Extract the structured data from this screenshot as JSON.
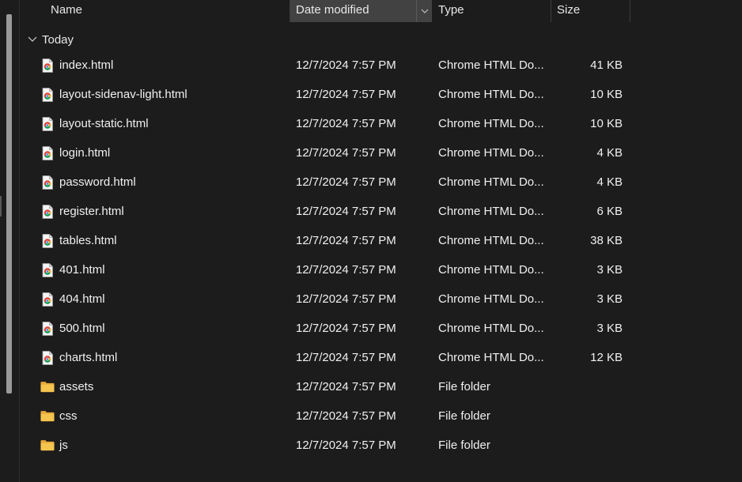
{
  "header": {
    "name_label": "Name",
    "date_label": "Date modified",
    "type_label": "Type",
    "size_label": "Size"
  },
  "group": {
    "label": "Today"
  },
  "files": [
    {
      "name": "index.html",
      "date": "12/7/2024 7:57 PM",
      "type": "Chrome HTML Do...",
      "size": "41 KB",
      "icon": "chrome-html-file-icon"
    },
    {
      "name": "layout-sidenav-light.html",
      "date": "12/7/2024 7:57 PM",
      "type": "Chrome HTML Do...",
      "size": "10 KB",
      "icon": "chrome-html-file-icon"
    },
    {
      "name": "layout-static.html",
      "date": "12/7/2024 7:57 PM",
      "type": "Chrome HTML Do...",
      "size": "10 KB",
      "icon": "chrome-html-file-icon"
    },
    {
      "name": "login.html",
      "date": "12/7/2024 7:57 PM",
      "type": "Chrome HTML Do...",
      "size": "4 KB",
      "icon": "chrome-html-file-icon"
    },
    {
      "name": "password.html",
      "date": "12/7/2024 7:57 PM",
      "type": "Chrome HTML Do...",
      "size": "4 KB",
      "icon": "chrome-html-file-icon"
    },
    {
      "name": "register.html",
      "date": "12/7/2024 7:57 PM",
      "type": "Chrome HTML Do...",
      "size": "6 KB",
      "icon": "chrome-html-file-icon"
    },
    {
      "name": "tables.html",
      "date": "12/7/2024 7:57 PM",
      "type": "Chrome HTML Do...",
      "size": "38 KB",
      "icon": "chrome-html-file-icon"
    },
    {
      "name": "401.html",
      "date": "12/7/2024 7:57 PM",
      "type": "Chrome HTML Do...",
      "size": "3 KB",
      "icon": "chrome-html-file-icon"
    },
    {
      "name": "404.html",
      "date": "12/7/2024 7:57 PM",
      "type": "Chrome HTML Do...",
      "size": "3 KB",
      "icon": "chrome-html-file-icon"
    },
    {
      "name": "500.html",
      "date": "12/7/2024 7:57 PM",
      "type": "Chrome HTML Do...",
      "size": "3 KB",
      "icon": "chrome-html-file-icon"
    },
    {
      "name": "charts.html",
      "date": "12/7/2024 7:57 PM",
      "type": "Chrome HTML Do...",
      "size": "12 KB",
      "icon": "chrome-html-file-icon"
    },
    {
      "name": "assets",
      "date": "12/7/2024 7:57 PM",
      "type": "File folder",
      "size": "",
      "icon": "folder-icon"
    },
    {
      "name": "css",
      "date": "12/7/2024 7:57 PM",
      "type": "File folder",
      "size": "",
      "icon": "folder-icon"
    },
    {
      "name": "js",
      "date": "12/7/2024 7:57 PM",
      "type": "File folder",
      "size": "",
      "icon": "folder-icon"
    }
  ],
  "colors": {
    "background": "#1c1c1c",
    "header_active": "#424242",
    "folder": "#f4c44e",
    "chrome_red": "#db4437",
    "chrome_green": "#0f9d58",
    "chrome_yellow": "#f4b400",
    "chrome_blue": "#4285f4"
  }
}
